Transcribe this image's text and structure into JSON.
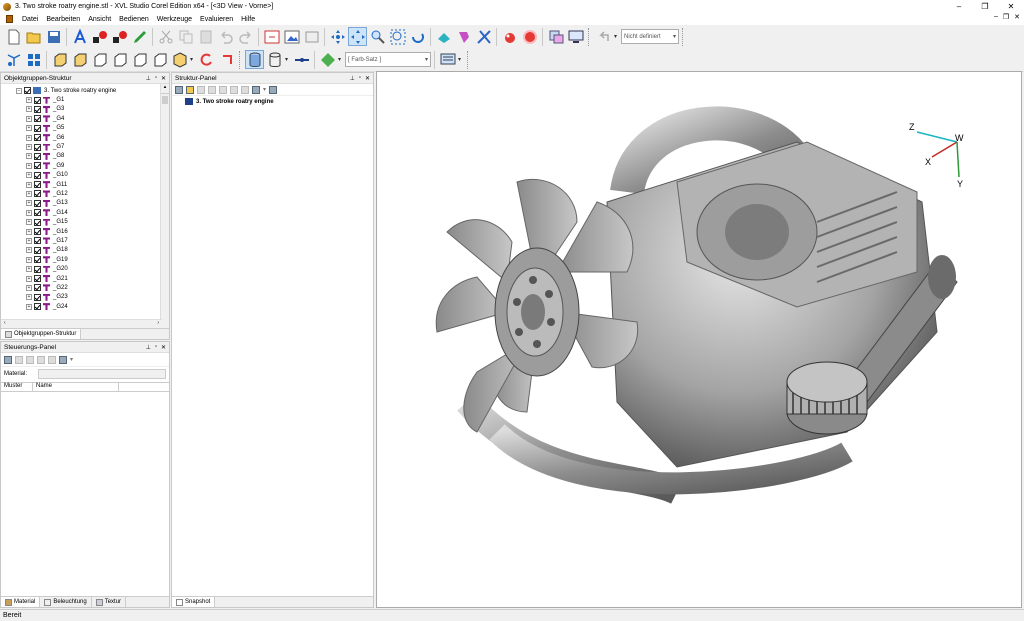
{
  "window": {
    "title": "3. Two stroke roatry engine.stl - XVL Studio Corel Edition x64 - [<3D View - Vorne>]",
    "minimize": "–",
    "maximize": "❐",
    "close": "✕"
  },
  "menu": {
    "items": [
      "Datei",
      "Bearbeiten",
      "Ansicht",
      "Bedienen",
      "Werkzeuge",
      "Evaluieren",
      "Hilfe"
    ],
    "mdi_minimize": "–",
    "mdi_restore": "❐",
    "mdi_close": "✕"
  },
  "toolbar": {
    "view_combo": "Nicht definiert",
    "color_set_combo": "[ Farb-Satz ]"
  },
  "object_tree_panel": {
    "title": "Objektgruppen-Struktur",
    "root": "3. Two stroke roatry engine",
    "groups": [
      "_G1",
      "_G3",
      "_G4",
      "_G5",
      "_G6",
      "_G7",
      "_G8",
      "_G9",
      "_G10",
      "_G11",
      "_G12",
      "_G13",
      "_G14",
      "_G15",
      "_G16",
      "_G17",
      "_G18",
      "_G19",
      "_G20",
      "_G21",
      "_G22",
      "_G23",
      "_G24"
    ],
    "tab_label": "Objektgruppen-Struktur"
  },
  "structure_panel": {
    "title": "Struktur-Panel",
    "item": "3. Two stroke roatry engine",
    "tab_label": "Snapshot"
  },
  "control_panel": {
    "title": "Steuerungs-Panel",
    "material_label": "Material:",
    "col_pattern": "Muster",
    "col_name": "Name",
    "tabs": [
      "Material",
      "Beleuchtung",
      "Textur"
    ]
  },
  "axes": {
    "z": "Z",
    "w": "W",
    "x": "X",
    "y": "Y"
  },
  "status": {
    "text": "Bereit"
  },
  "colors": {
    "axis_z": "#1ab5c0",
    "axis_x": "#c62828",
    "axis_y": "#2e9a3a",
    "engine_body": "#a8a8a8",
    "group_icon": "#8b1a8b"
  }
}
